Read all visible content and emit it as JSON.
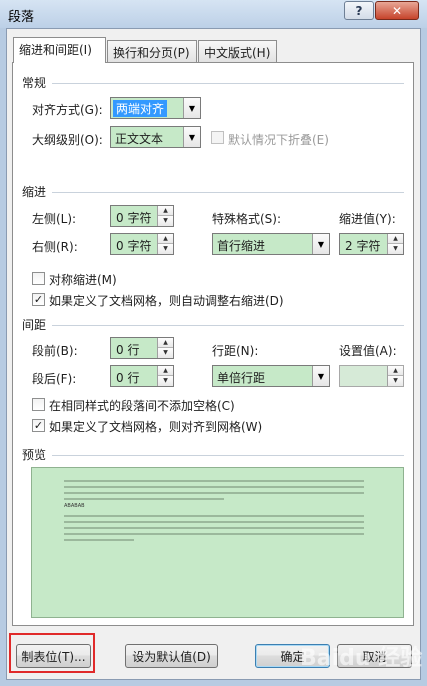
{
  "window": {
    "title": "段落",
    "help_label": "?",
    "close_label": "✕"
  },
  "tabs": [
    {
      "label": "缩进和间距(I)"
    },
    {
      "label": "换行和分页(P)"
    },
    {
      "label": "中文版式(H)"
    }
  ],
  "general": {
    "heading": "常规",
    "alignment": {
      "label": "对齐方式(G):",
      "value": "两端对齐"
    },
    "outline": {
      "label": "大纲级别(O):",
      "value": "正文文本"
    },
    "collapse_default": {
      "label": "默认情况下折叠(E)",
      "checked": false,
      "enabled": false
    }
  },
  "indent": {
    "heading": "缩进",
    "left": {
      "label": "左侧(L):",
      "value": "0 字符"
    },
    "right": {
      "label": "右侧(R):",
      "value": "0 字符"
    },
    "special": {
      "label": "特殊格式(S):",
      "value": "首行缩进"
    },
    "by": {
      "label": "缩进值(Y):",
      "value": "2 字符"
    },
    "mirror": {
      "label": "对称缩进(M)",
      "checked": false
    },
    "auto_adjust": {
      "label": "如果定义了文档网格，则自动调整右缩进(D)",
      "checked": true
    }
  },
  "spacing": {
    "heading": "间距",
    "before": {
      "label": "段前(B):",
      "value": "0 行"
    },
    "after": {
      "label": "段后(F):",
      "value": "0 行"
    },
    "line": {
      "label": "行距(N):",
      "value": "单倍行距"
    },
    "at": {
      "label": "设置值(A):",
      "value": ""
    },
    "no_space_same_style": {
      "label": "在相同样式的段落间不添加空格(C)",
      "checked": false
    },
    "snap_grid": {
      "label": "如果定义了文档网格，则对齐到网格(W)",
      "checked": true
    }
  },
  "preview": {
    "heading": "预览",
    "sample_text": "ABABAB"
  },
  "buttons": {
    "tabs": "制表位(T)...",
    "set_default": "设为默认值(D)",
    "ok": "确定",
    "cancel": "取消"
  },
  "watermark": "Baidu 经验",
  "colors": {
    "field_green": "#c6e9c8",
    "highlight": "#3399ff",
    "annotation_red": "#e02a2a"
  },
  "icons": [
    "dropdown-arrow-icon",
    "spin-up-icon",
    "spin-down-icon",
    "checkmark-icon"
  ]
}
